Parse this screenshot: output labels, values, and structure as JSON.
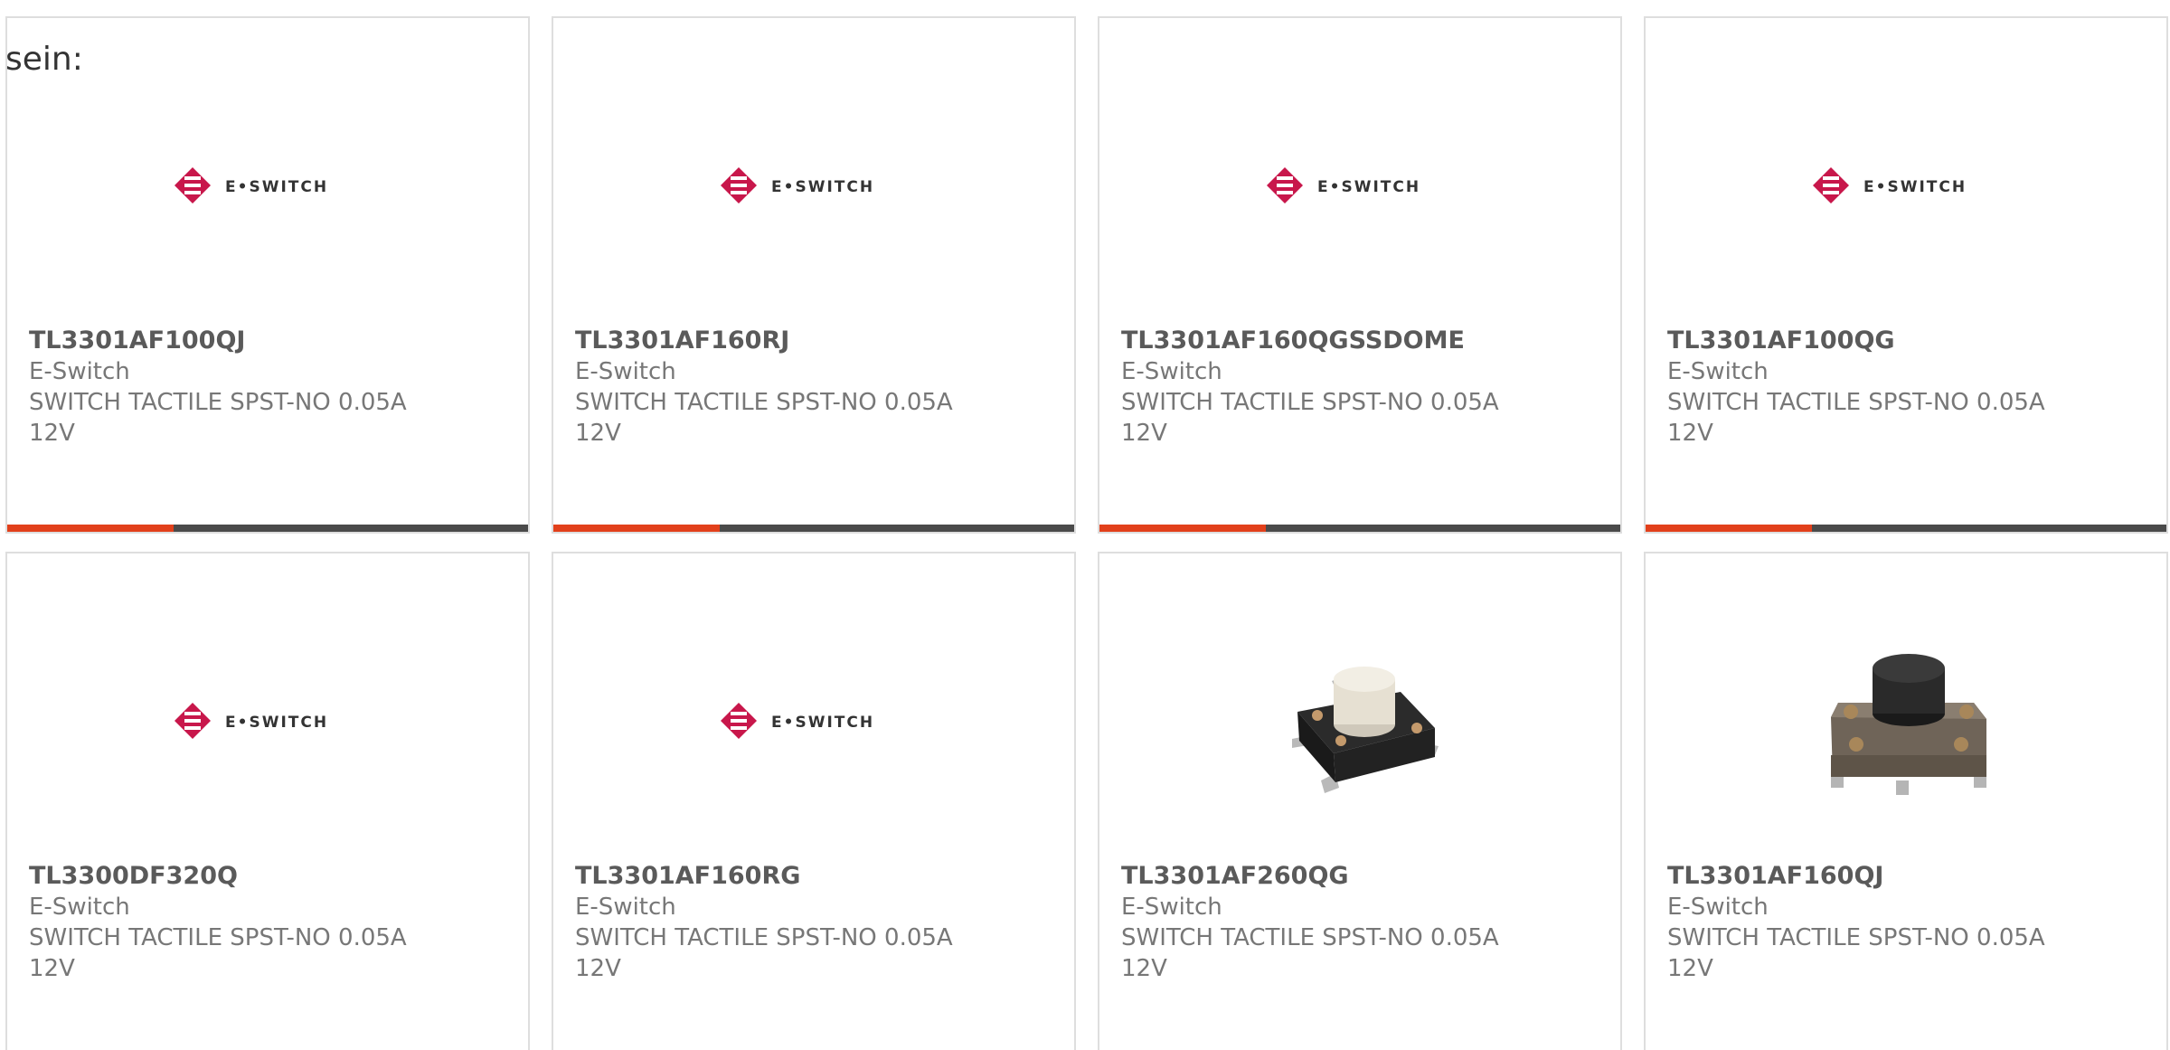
{
  "leading_text": "sein:",
  "brand_logo_text": "E•SWITCH",
  "colors": {
    "accent": "#e2401b",
    "bar_dark": "#4a4a4a",
    "logo_pink": "#c8174b",
    "card_border": "#dedede"
  },
  "products": [
    {
      "part_number": "TL3301AF100QJ",
      "manufacturer": "E-Switch",
      "description": "SWITCH TACTILE SPST-NO 0.05A 12V",
      "image": "e-switch-logo"
    },
    {
      "part_number": "TL3301AF160RJ",
      "manufacturer": "E-Switch",
      "description": "SWITCH TACTILE SPST-NO 0.05A 12V",
      "image": "e-switch-logo"
    },
    {
      "part_number": "TL3301AF160QGSSDOME",
      "manufacturer": "E-Switch",
      "description": "SWITCH TACTILE SPST-NO 0.05A 12V",
      "image": "e-switch-logo"
    },
    {
      "part_number": "TL3301AF100QG",
      "manufacturer": "E-Switch",
      "description": "SWITCH TACTILE SPST-NO 0.05A 12V",
      "image": "e-switch-logo"
    },
    {
      "part_number": "TL3300DF320Q",
      "manufacturer": "E-Switch",
      "description": "SWITCH TACTILE SPST-NO 0.05A 12V",
      "image": "e-switch-logo"
    },
    {
      "part_number": "TL3301AF160RG",
      "manufacturer": "E-Switch",
      "description": "SWITCH TACTILE SPST-NO 0.05A 12V",
      "image": "e-switch-logo"
    },
    {
      "part_number": "TL3301AF260QG",
      "manufacturer": "E-Switch",
      "description": "SWITCH TACTILE SPST-NO 0.05A 12V",
      "image": "tactile-switch-white-button"
    },
    {
      "part_number": "TL3301AF160QJ",
      "manufacturer": "E-Switch",
      "description": "SWITCH TACTILE SPST-NO 0.05A 12V",
      "image": "tactile-switch-black-button"
    }
  ]
}
